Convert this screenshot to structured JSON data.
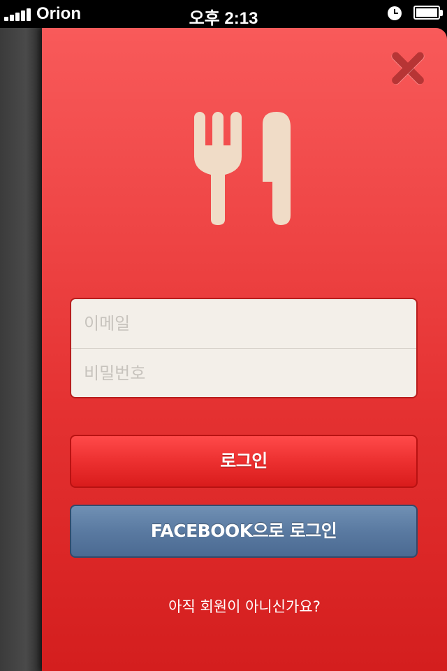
{
  "status_bar": {
    "carrier": "Orion",
    "time": "오후 2:13",
    "icons": [
      "signal-icon",
      "clock-icon",
      "battery-icon"
    ]
  },
  "logo": {
    "icon": "fork-knife-icon",
    "color": "#f0dcc7"
  },
  "close": {
    "icon": "close-icon",
    "color": "#b73535"
  },
  "form": {
    "email_placeholder": "이메일",
    "email_value": "",
    "password_placeholder": "비밀번호",
    "password_value": ""
  },
  "buttons": {
    "login_label": "로그인",
    "facebook_login_label": "FACEBOOK으로 로그인"
  },
  "signup_link": "아직 회원이 아니신가요?",
  "colors": {
    "panel_red": "#e43131",
    "facebook_blue": "#5a7aa1",
    "field_bg": "#f3efe9"
  }
}
